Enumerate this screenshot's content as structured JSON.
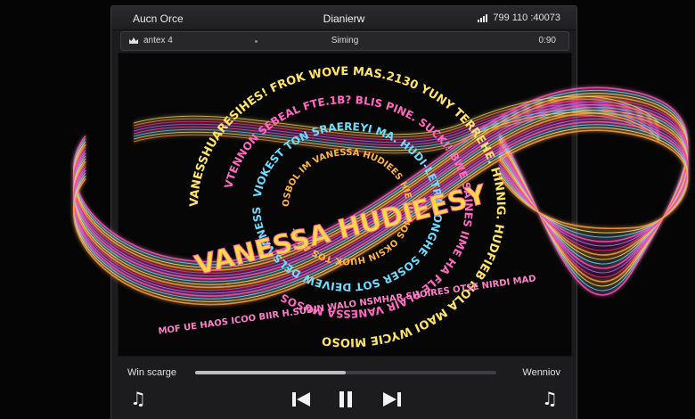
{
  "window": {
    "app_name": "Aucn Orce",
    "title": "Dianierw",
    "status_text": "799 110 :40073"
  },
  "subbar": {
    "left_label": "antex 4",
    "center_label": "Siming",
    "right_label": "0:90"
  },
  "player": {
    "left_label": "Win scarge",
    "right_label": "Wenniov",
    "progress": 0.5
  },
  "icons": {
    "left": "music-note-icon",
    "prev": "previous-track-icon",
    "play_pause": "pause-icon",
    "next": "next-track-icon",
    "right": "music-note-icon"
  },
  "artwork": {
    "headline": "VANESSA HUDIEESY",
    "ring_outer": "VANESSHUARESIHES! FROK WOVE MAS.2130 YUNY TERREHE. HINNIG. HUDFIEB HOLA MAOI WYCIE MIOSO",
    "ring_middle": "VTENNON SEBEAL FTE.1B? BLIS PINE. SUCKI! BWE SAINES IIME HA FLE PLAIR VANESSA MUSOS",
    "ring_inner": "VIOKEST TON SRAEREYI MA. HUDI-LETRA JONGHE SOSER SOT DEIVEW DELS VANESSYHUARESEIST",
    "ring_core": "OSBOL IM VANESSA HUDIEES HIE UHNOS OKSIN HUOK TOS AVHL",
    "bottom_words": "MOF UE HAOS ICOO BIIR H.SUDIN WALO NSMHAR SHOIRES OTSE NIRDI MAD"
  },
  "colors": {
    "accent": "#ff4fb4",
    "cyan": "#5fd6ff",
    "yellow": "#ffe36a",
    "orange": "#ff9a3c"
  }
}
